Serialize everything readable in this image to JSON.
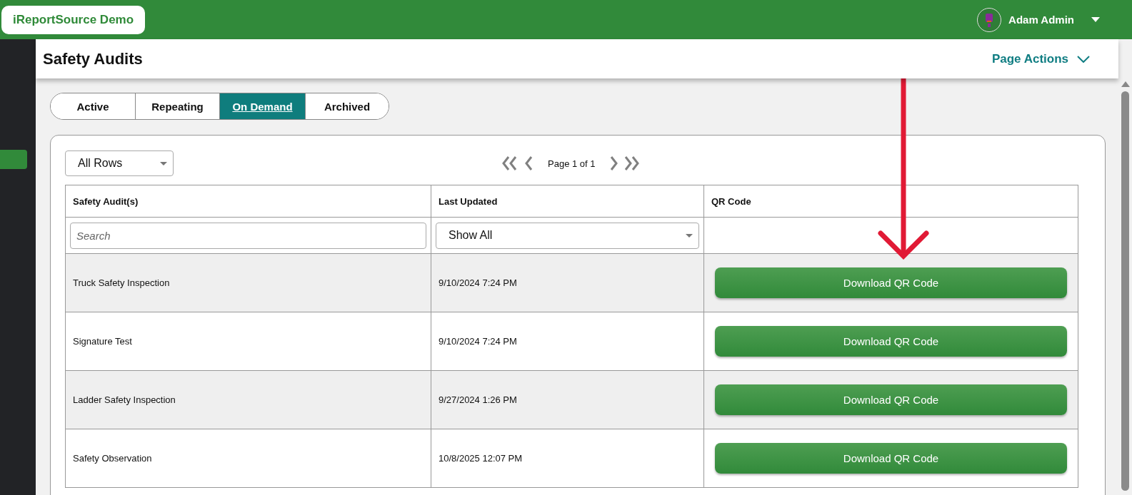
{
  "app": {
    "title": "iReportSource Demo"
  },
  "user": {
    "name": "Adam Admin"
  },
  "page": {
    "title": "Safety Audits",
    "actions_label": "Page Actions"
  },
  "tabs": [
    {
      "label": "Active",
      "selected": false
    },
    {
      "label": "Repeating",
      "selected": false
    },
    {
      "label": "On Demand",
      "selected": true
    },
    {
      "label": "Archived",
      "selected": false
    }
  ],
  "rows_select": {
    "value": "All Rows"
  },
  "pager": {
    "label": "Page 1 of 1"
  },
  "table": {
    "columns": [
      "Safety Audit(s)",
      "Last Updated",
      "QR Code"
    ],
    "search": {
      "placeholder": "Search"
    },
    "date_filter": {
      "value": "Show All"
    },
    "rows": [
      {
        "name": "Truck Safety Inspection",
        "updated": "9/10/2024 7:24 PM",
        "action": "Download QR Code"
      },
      {
        "name": "Signature Test",
        "updated": "9/10/2024 7:24 PM",
        "action": "Download QR Code"
      },
      {
        "name": "Ladder Safety Inspection",
        "updated": "9/27/2024 1:26 PM",
        "action": "Download QR Code"
      },
      {
        "name": "Safety Observation",
        "updated": "10/8/2025 12:07 PM",
        "action": "Download QR Code"
      }
    ]
  }
}
